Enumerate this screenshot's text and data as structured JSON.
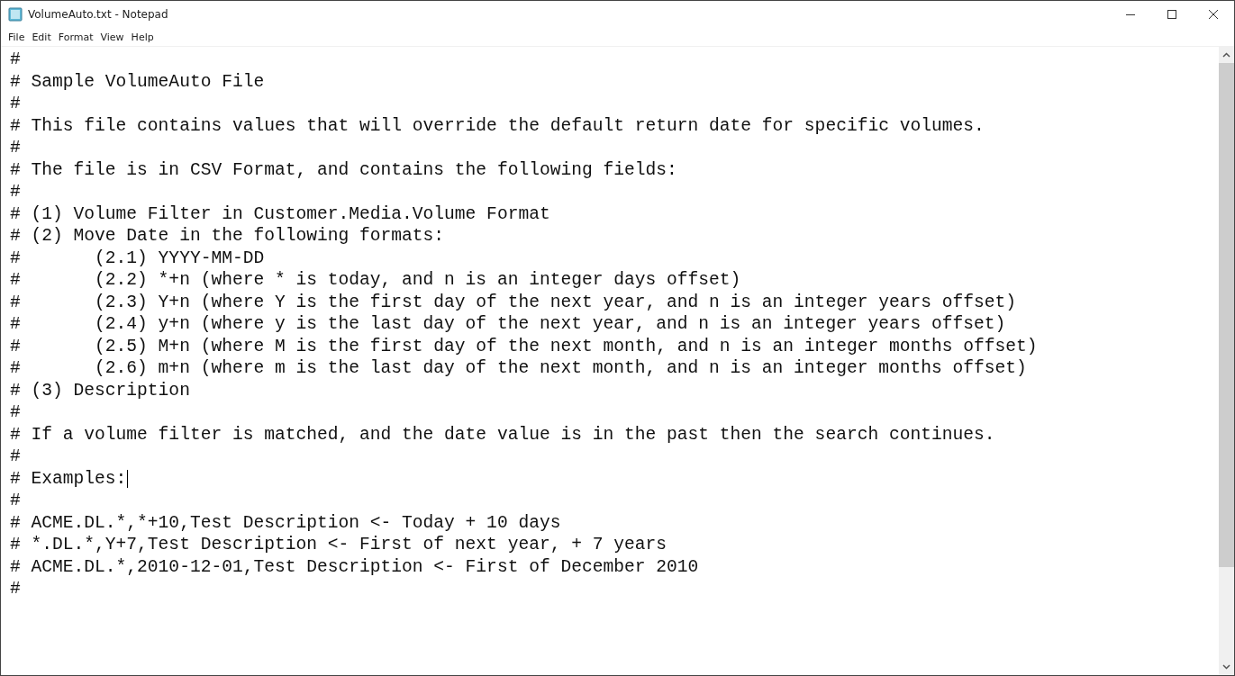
{
  "window": {
    "title": "VolumeAuto.txt - Notepad"
  },
  "menu": [
    "File",
    "Edit",
    "Format",
    "View",
    "Help"
  ],
  "lines": [
    {
      "text": "#",
      "caret": false
    },
    {
      "text": "# Sample VolumeAuto File",
      "caret": false
    },
    {
      "text": "#",
      "caret": false
    },
    {
      "text": "# This file contains values that will override the default return date for specific volumes.",
      "caret": false
    },
    {
      "text": "#",
      "caret": false
    },
    {
      "text": "# The file is in CSV Format, and contains the following fields:",
      "caret": false
    },
    {
      "text": "#",
      "caret": false
    },
    {
      "text": "# (1) Volume Filter in Customer.Media.Volume Format",
      "caret": false
    },
    {
      "text": "# (2) Move Date in the following formats:",
      "caret": false
    },
    {
      "text": "#       (2.1) YYYY-MM-DD",
      "caret": false
    },
    {
      "text": "#       (2.2) *+n (where * is today, and n is an integer days offset)",
      "caret": false
    },
    {
      "text": "#       (2.3) Y+n (where Y is the first day of the next year, and n is an integer years offset)",
      "caret": false
    },
    {
      "text": "#       (2.4) y+n (where y is the last day of the next year, and n is an integer years offset)",
      "caret": false
    },
    {
      "text": "#       (2.5) M+n (where M is the first day of the next month, and n is an integer months offset)",
      "caret": false
    },
    {
      "text": "#       (2.6) m+n (where m is the last day of the next month, and n is an integer months offset)",
      "caret": false
    },
    {
      "text": "# (3) Description",
      "caret": false
    },
    {
      "text": "#",
      "caret": false
    },
    {
      "text": "# If a volume filter is matched, and the date value is in the past then the search continues.",
      "caret": false
    },
    {
      "text": "#",
      "caret": false
    },
    {
      "text": "# Examples:",
      "caret": true
    },
    {
      "text": "#",
      "caret": false
    },
    {
      "text": "# ACME.DL.*,*+10,Test Description <- Today + 10 days",
      "caret": false
    },
    {
      "text": "# *.DL.*,Y+7,Test Description <- First of next year, + 7 years",
      "caret": false
    },
    {
      "text": "# ACME.DL.*,2010-12-01,Test Description <- First of December 2010",
      "caret": false
    },
    {
      "text": "#",
      "caret": false
    }
  ]
}
